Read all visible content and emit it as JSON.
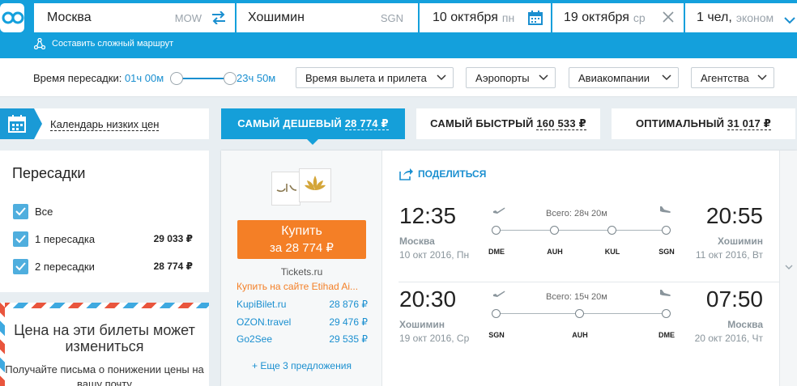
{
  "header": {
    "from_city": "Москва",
    "from_code": "MOW",
    "to_city": "Хошимин",
    "to_code": "SGN",
    "depart_date": "10 октября",
    "depart_day": "пн",
    "return_date": "19 октября",
    "return_day": "ср",
    "passengers": "1 чел,",
    "class": "эконом",
    "complex_route": "Составить сложный маршрут"
  },
  "filters": {
    "transfer_time_label": "Время пересадки:",
    "transfer_min": "01ч 00м",
    "transfer_max": "23ч 50м",
    "dropdowns": [
      "Время вылета и прилета",
      "Аэропорты",
      "Авиакомпании",
      "Агентства"
    ]
  },
  "calendar": {
    "label": "Календарь низких цен"
  },
  "tabs": {
    "cheapest": {
      "label": "САМЫЙ ДЕШЕВЫЙ",
      "price": "28 774 ₽"
    },
    "fastest": {
      "label": "САМЫЙ БЫСТРЫЙ",
      "price": "160 533 ₽"
    },
    "optimal": {
      "label": "ОПТИМАЛЬНЫЙ",
      "price": "31 017 ₽"
    }
  },
  "sidebar": {
    "title": "Пересадки",
    "options": [
      {
        "label": "Все",
        "price": ""
      },
      {
        "label": "1 пересадка",
        "price": "29 033 ₽"
      },
      {
        "label": "2 пересадки",
        "price": "28 774 ₽"
      }
    ],
    "notice_title": "Цена на эти билеты может измениться",
    "notice_text": "Получайте письма о понижении цены на вашу почту"
  },
  "ticket": {
    "buy_label": "Купить",
    "buy_price": "за 28 774 ₽",
    "agent": "Tickets.ru",
    "buy_on_site": "Купить на сайте Etihad Ai...",
    "alternatives": [
      {
        "name": "KupiBilet.ru",
        "price": "28 876 ₽"
      },
      {
        "name": "OZON.travel",
        "price": "29 476 ₽"
      },
      {
        "name": "Go2See",
        "price": "29 535 ₽"
      }
    ],
    "more_offers": "+ Еще 3 предложения",
    "share": "ПОДЕЛИТЬСЯ",
    "segments": [
      {
        "dep_time": "12:35",
        "dep_city": "Москва",
        "dep_date": "10 окт 2016, Пн",
        "arr_time": "20:55",
        "arr_city": "Хошимин",
        "arr_date": "11 окт 2016, Вт",
        "total": "Всего: 28ч 20м",
        "airports": [
          "DME",
          "AUH",
          "KUL",
          "SGN"
        ]
      },
      {
        "dep_time": "20:30",
        "dep_city": "Хошимин",
        "dep_date": "19 окт 2016, Ср",
        "arr_time": "07:50",
        "arr_city": "Москва",
        "arr_date": "20 окт 2016, Чт",
        "total": "Всего: 15ч 20м",
        "airports": [
          "SGN",
          "AUH",
          "DME"
        ]
      }
    ]
  },
  "colors": {
    "brand_blue": "#14a0dc",
    "buy_orange": "#f47f26",
    "link_blue": "#1a8fd0"
  }
}
